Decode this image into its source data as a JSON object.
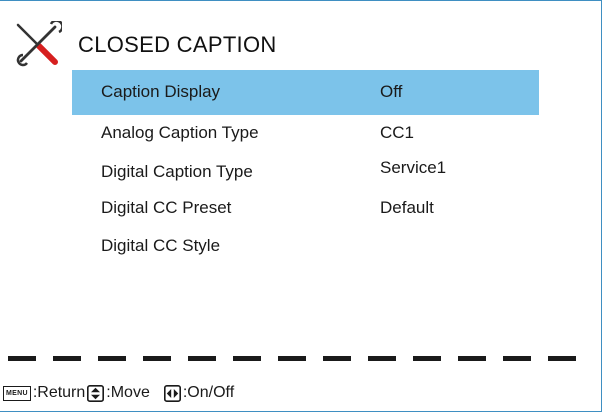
{
  "menu": {
    "title": "CLOSED CAPTION",
    "icon": "tools-icon",
    "items": [
      {
        "label": "Caption Display",
        "value": "Off",
        "selected": true
      },
      {
        "label": "Analog Caption Type",
        "value": "CC1"
      },
      {
        "label": "Digital Caption Type",
        "value": "Service1"
      },
      {
        "label": "Digital CC Preset",
        "value": "Default"
      },
      {
        "label": "Digital CC Style",
        "value": ""
      }
    ]
  },
  "footer": {
    "menu_key": "MENU",
    "return_label": ":Return",
    "move_label": ":Move",
    "onoff_label": ":On/Off"
  },
  "colors": {
    "highlight": "#7cc3ea",
    "border": "#3f8fc2",
    "text": "#1a1a1a"
  }
}
